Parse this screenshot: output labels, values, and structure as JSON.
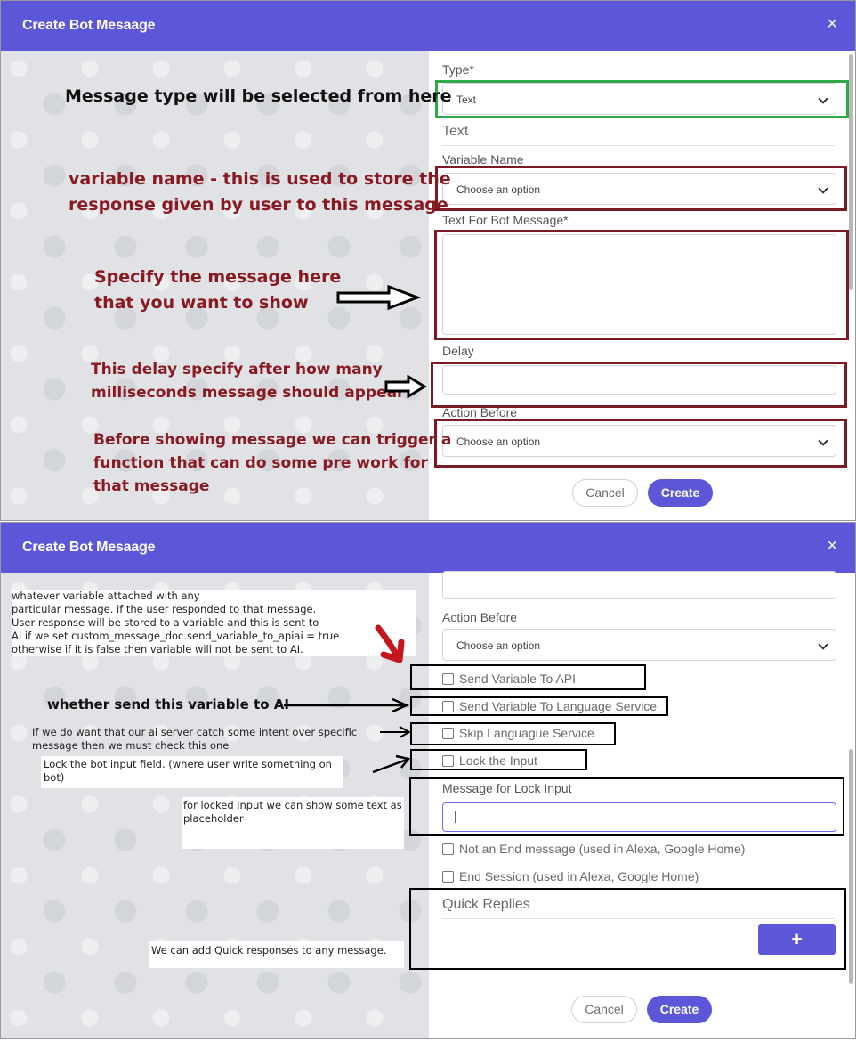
{
  "dialog_title": "Create Bot Mesaage",
  "close_symbol": "×",
  "panel1": {
    "type_label": "Type*",
    "type_value": "Text",
    "text_section": "Text",
    "variable_name_label": "Variable Name",
    "variable_name_value": "Choose an option",
    "text_for_bot_label": "Text For Bot Message*",
    "delay_label": "Delay",
    "action_before_label": "Action Before",
    "action_before_value": "Choose an option",
    "cancel": "Cancel",
    "create": "Create"
  },
  "panel2": {
    "action_before_label": "Action Before",
    "action_before_value": "Choose an option",
    "checks": [
      "Send Variable To API",
      "Send Variable To Language Service",
      "Skip Languague Service",
      "Lock the Input"
    ],
    "lock_msg_label": "Message for Lock Input",
    "lock_msg_value": "|",
    "check_not_end": "Not an End message (used in Alexa, Google Home)",
    "check_end_session": "End Session (used in Alexa, Google Home)",
    "quick_replies": "Quick Replies",
    "plus": "+",
    "cancel": "Cancel",
    "create": "Create"
  },
  "annotations1": {
    "type_note": "Message type will be selected from here",
    "variable_note_1": "variable name - this is used to store the",
    "variable_note_2": "response given by user to this message",
    "message_note_1": "Specify the message here",
    "message_note_2": "that you want to show",
    "delay_note_1": "This delay specify after how many",
    "delay_note_2": "milliseconds message should appear",
    "action_note_1": "Before showing message  we can trigger a",
    "action_note_2": "function that can do some pre work for",
    "action_note_3": "that message"
  },
  "annotations2": {
    "var_note": [
      "whatever variable attached with any",
      " particular message. if the user responded to that message.",
      "User response will be stored to a variable and this is sent to",
      "AI if we set custom_message_doc.send_variable_to_apiai = true",
      "otherwise if it is false then variable will not be sent to AI."
    ],
    "send_ai_note": "whether send this variable to AI",
    "intent_note_1": "If we do want that our ai server catch some intent over specific",
    "intent_note_2": "message then we must check this one",
    "lock_note": "Lock the bot input field. (where user write something on bot)",
    "placeholder_note": "for locked input we can show some text as placeholder",
    "quick_note": "We can add Quick responses to any message."
  },
  "colors": {
    "header": "#5b57d8",
    "annotation_red": "#8a1a22",
    "outline_green": "#2fa84a"
  }
}
